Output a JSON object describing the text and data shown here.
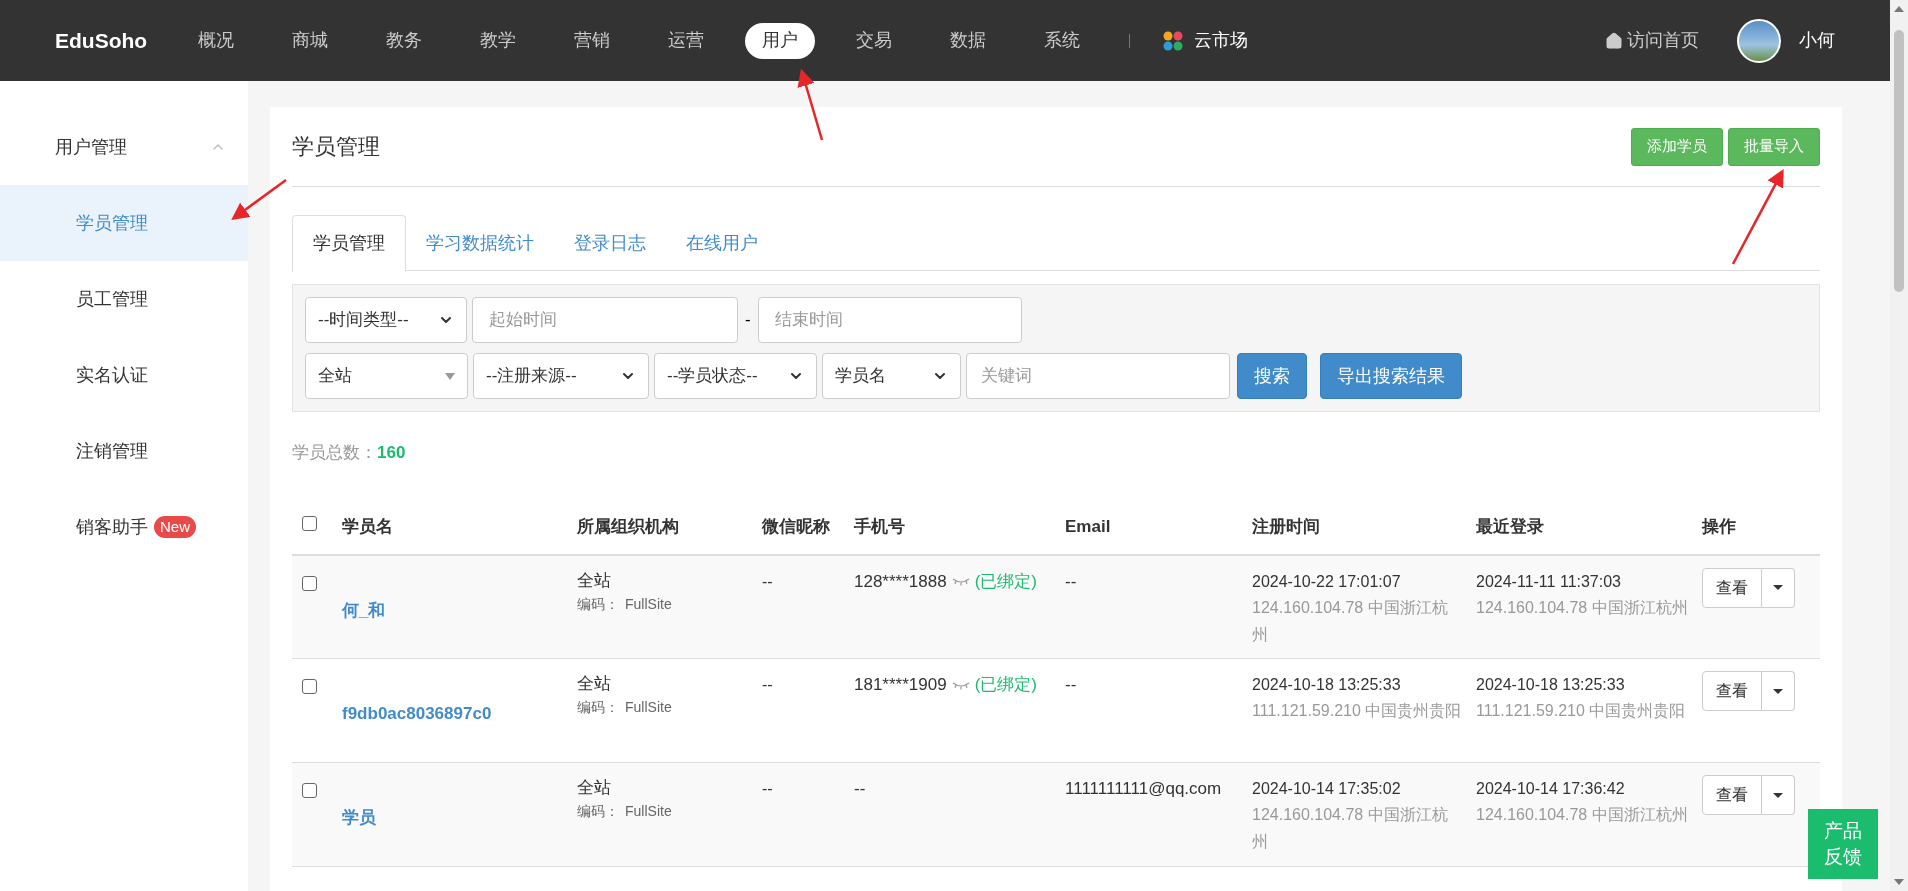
{
  "topbar": {
    "brand": "EduSoho",
    "nav": [
      {
        "label": "概况",
        "selected": false
      },
      {
        "label": "商城",
        "selected": false
      },
      {
        "label": "教务",
        "selected": false
      },
      {
        "label": "教学",
        "selected": false
      },
      {
        "label": "营销",
        "selected": false
      },
      {
        "label": "运营",
        "selected": false
      },
      {
        "label": "用户",
        "selected": true
      },
      {
        "label": "交易",
        "selected": false
      },
      {
        "label": "数据",
        "selected": false
      },
      {
        "label": "系统",
        "selected": false
      }
    ],
    "market": "云市场",
    "home_link": "访问首页",
    "user": "小何"
  },
  "sidebar": {
    "group": {
      "label": "用户管理",
      "expanded": true
    },
    "items": [
      {
        "label": "学员管理",
        "selected": true
      },
      {
        "label": "员工管理",
        "selected": false
      },
      {
        "label": "实名认证",
        "selected": false
      },
      {
        "label": "注销管理",
        "selected": false
      },
      {
        "label": "销客助手",
        "selected": false,
        "badge": "New"
      }
    ]
  },
  "page": {
    "title": "学员管理",
    "buttons": [
      "添加学员",
      "批量导入"
    ],
    "tabs": [
      {
        "label": "学员管理",
        "selected": true
      },
      {
        "label": "学习数据统计",
        "selected": false
      },
      {
        "label": "登录日志",
        "selected": false
      },
      {
        "label": "在线用户",
        "selected": false
      }
    ],
    "filters": {
      "time_type": "--时间类型--",
      "start_placeholder": "起始时间",
      "range_dash": "-",
      "end_placeholder": "结束时间",
      "site": "全站",
      "source": "--注册来源--",
      "status": "--学员状态--",
      "field": "学员名",
      "keyword_placeholder": "关键词",
      "search_button": "搜索",
      "export_button": "导出搜索结果"
    },
    "total_label": "学员总数：",
    "total": "160",
    "table": {
      "all_checked": false,
      "columns": [
        "学员名",
        "所属组织机构",
        "微信昵称",
        "手机号",
        "Email",
        "注册时间",
        "最近登录",
        "操作"
      ],
      "rows": [
        {
          "checked": false,
          "name": "何_和",
          "org": "全站",
          "org_code_label": "编码：",
          "org_code": "FullSite",
          "wechat": "--",
          "phone": "128****1888",
          "bound": "(已绑定)",
          "email": "--",
          "reg_time": "2024-10-22 17:01:07",
          "reg_ip": "124.160.104.78 中国浙江杭州",
          "last_time": "2024-11-11 11:37:03",
          "last_ip": "124.160.104.78 中国浙江杭州",
          "action": "查看"
        },
        {
          "checked": false,
          "name": "f9db0ac8036897c0",
          "org": "全站",
          "org_code_label": "编码：",
          "org_code": "FullSite",
          "wechat": "--",
          "phone": "181****1909",
          "bound": "(已绑定)",
          "email": "--",
          "reg_time": "2024-10-18 13:25:33",
          "reg_ip": "111.121.59.210 中国贵州贵阳",
          "last_time": "2024-10-18 13:25:33",
          "last_ip": "111.121.59.210 中国贵州贵阳",
          "action": "查看"
        },
        {
          "checked": false,
          "name": "学员",
          "org": "全站",
          "org_code_label": "编码：",
          "org_code": "FullSite",
          "wechat": "--",
          "phone": "--",
          "email": "1111111111@qq.com",
          "reg_time": "2024-10-14 17:35:02",
          "reg_ip": "124.160.104.78 中国浙江杭州",
          "last_time": "2024-10-14 17:36:42",
          "last_ip": "124.160.104.78 中国浙江杭州",
          "action": "查看"
        }
      ]
    }
  },
  "feedback_button": "产品反馈"
}
